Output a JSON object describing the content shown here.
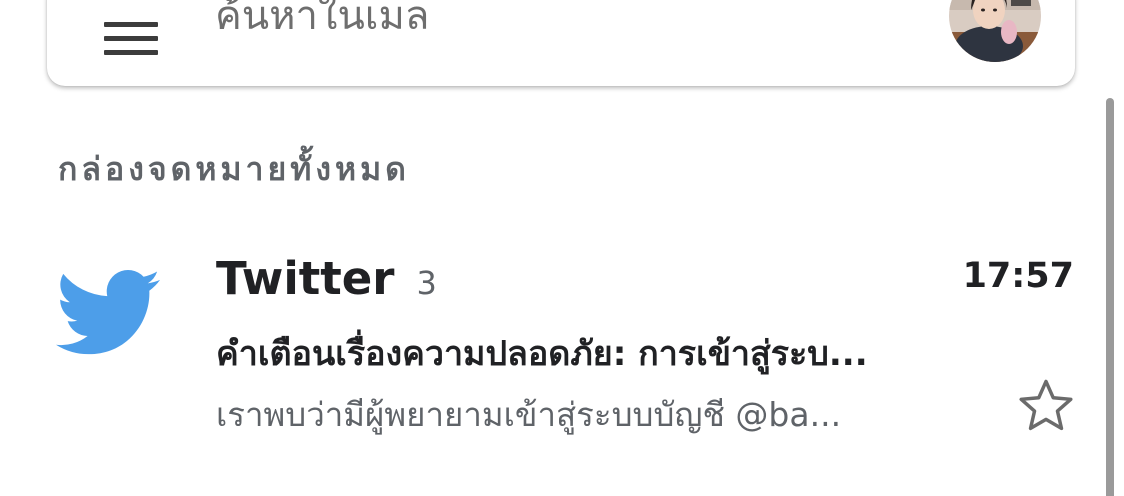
{
  "search": {
    "placeholder": "ค้นหาในเมล"
  },
  "mailbox": {
    "title": "กล่องจดหมายทั้งหมด"
  },
  "mail_items": [
    {
      "sender": "Twitter",
      "count": "3",
      "time": "17:57",
      "subject": "คำเตือนเรื่องความปลอดภัย: การเข้าสู่ระบ...",
      "snippet": "เราพบว่ามีผู้พยายามเข้าสู่ระบบบัญชี @ba...",
      "icon": "twitter-bird-icon",
      "starred": false
    }
  ],
  "colors": {
    "twitter_blue": "#4d9ee9",
    "text_primary": "#202124",
    "text_secondary": "#5f6368",
    "scrollbar": "#9a9a9a"
  }
}
